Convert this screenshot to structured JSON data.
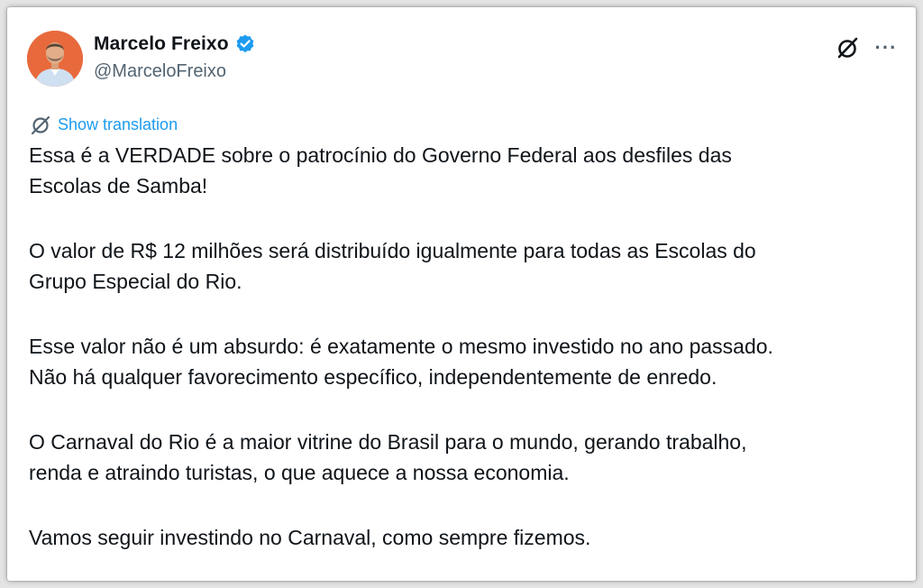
{
  "author": {
    "name": "Marcelo Freixo",
    "handle": "@MarceloFreixo",
    "verified": true,
    "verified_color": "#1d9bf0",
    "avatar_background": "#e86a3c"
  },
  "actions": {
    "grok_icon": "grok-slash-circle-icon",
    "more_icon": "more-horizontal-icon",
    "more_label": "···"
  },
  "translate": {
    "icon": "globe-slash-icon",
    "label": "Show translation",
    "color": "#1d9bf0"
  },
  "tweet": {
    "paragraphs": [
      [
        "Essa é a VERDADE sobre o patrocínio do Governo Federal aos desfiles das",
        "Escolas de Samba!"
      ],
      [
        "O valor de R$ 12 milhões será distribuído igualmente para todas as Escolas do",
        "Grupo Especial do Rio."
      ],
      [
        "Esse valor não é um absurdo: é exatamente o mesmo investido no ano passado.",
        "Não há qualquer favorecimento específico, independentemente de enredo."
      ],
      [
        "O Carnaval do Rio é a maior vitrine do Brasil para o mundo, gerando trabalho,",
        "renda e atraindo turistas, o que aquece a nossa economia."
      ],
      [
        "Vamos seguir investindo no Carnaval, como sempre fizemos."
      ]
    ]
  }
}
